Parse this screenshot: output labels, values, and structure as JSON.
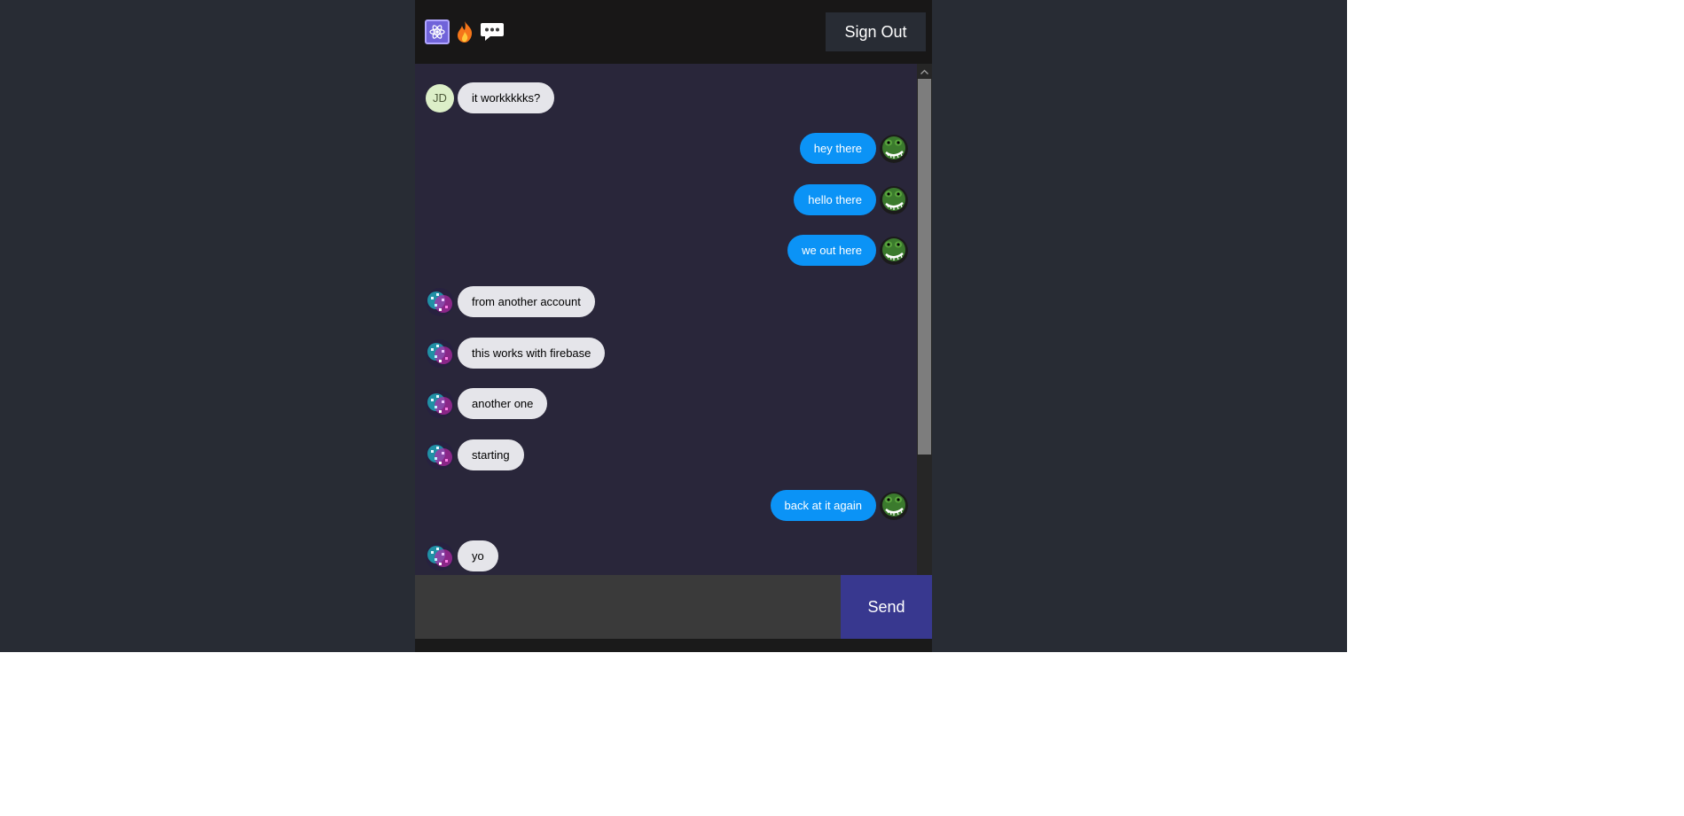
{
  "header": {
    "icons": [
      "react-icon",
      "fire-icon",
      "chat-bubble-icon"
    ],
    "signout_label": "Sign Out"
  },
  "messages": [
    {
      "side": "received",
      "avatar": "initials",
      "initials": "JD",
      "text": "it workkkkks?"
    },
    {
      "side": "sent",
      "avatar": "frog-avatar",
      "text": "hey there"
    },
    {
      "side": "sent",
      "avatar": "frog-avatar",
      "text": "hello there"
    },
    {
      "side": "sent",
      "avatar": "frog-avatar",
      "text": "we out here"
    },
    {
      "side": "received",
      "avatar": "pixel-avatar",
      "text": "from another account"
    },
    {
      "side": "received",
      "avatar": "pixel-avatar",
      "text": "this works with firebase"
    },
    {
      "side": "received",
      "avatar": "pixel-avatar",
      "text": "another one"
    },
    {
      "side": "received",
      "avatar": "pixel-avatar",
      "text": "starting"
    },
    {
      "side": "sent",
      "avatar": "frog-avatar",
      "text": "back at it again"
    },
    {
      "side": "received",
      "avatar": "pixel-avatar",
      "text": "yo"
    }
  ],
  "form": {
    "input_value": "",
    "input_placeholder": "",
    "send_label": "Send"
  },
  "colors": {
    "page_bg": "#282c34",
    "header_bg": "#181717",
    "main_bg": "#29263a",
    "received_bubble": "#e5e5ea",
    "sent_bubble": "#0b93f6",
    "send_button": "#38388f"
  }
}
